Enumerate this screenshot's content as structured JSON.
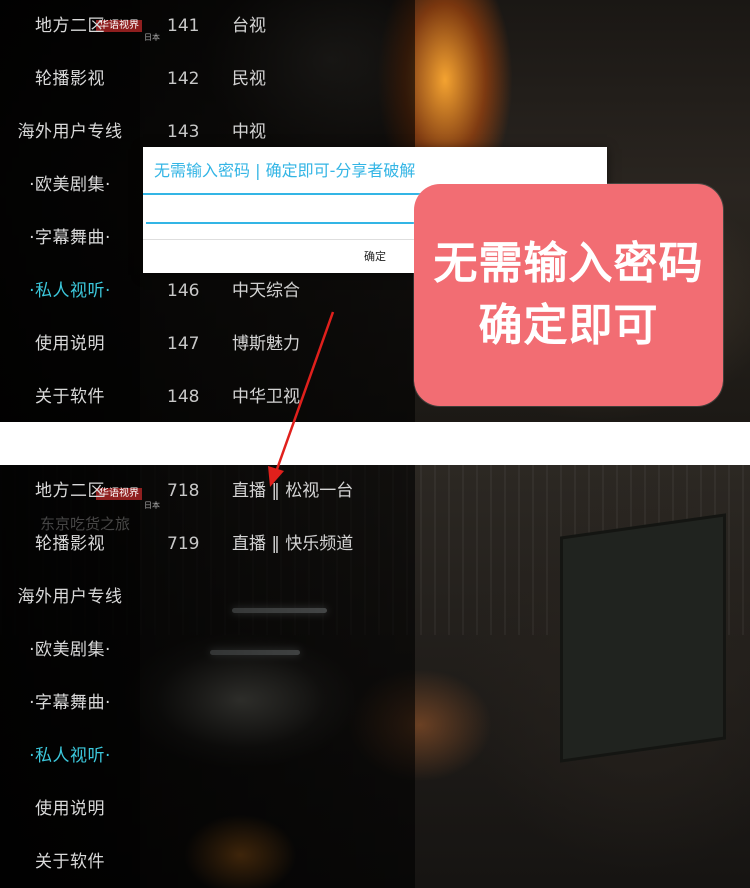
{
  "top_screen": {
    "menu": [
      {
        "label": "地方二区",
        "active": false
      },
      {
        "label": "轮播影视",
        "active": false
      },
      {
        "label": "海外用户专线",
        "active": false
      },
      {
        "label": "·欧美剧集·",
        "active": false
      },
      {
        "label": "·字幕舞曲·",
        "active": false
      },
      {
        "label": "·私人视听·",
        "active": true
      },
      {
        "label": "使用说明",
        "active": false
      },
      {
        "label": "关于软件",
        "active": false
      }
    ],
    "channels": [
      {
        "number": "141",
        "name": "台视"
      },
      {
        "number": "142",
        "name": "民视"
      },
      {
        "number": "143",
        "name": "中视"
      },
      {
        "number": "146",
        "name": "中天综合"
      },
      {
        "number": "147",
        "name": "博斯魅力"
      },
      {
        "number": "148",
        "name": "中华卫视"
      }
    ],
    "logo": {
      "title": "华语视界",
      "sub": "日本"
    }
  },
  "dialog": {
    "title": "无需输入密码 | 确定即可-分享者破解",
    "input_value": "",
    "ok_label": "确定"
  },
  "callout": {
    "line1": "无需输入密码",
    "line2": "确定即可",
    "color": "#f26d73"
  },
  "bottom_screen": {
    "menu": [
      {
        "label": "地方二区",
        "active": false
      },
      {
        "label": "轮播影视",
        "active": false
      },
      {
        "label": "海外用户专线",
        "active": false
      },
      {
        "label": "·欧美剧集·",
        "active": false
      },
      {
        "label": "·字幕舞曲·",
        "active": false
      },
      {
        "label": "·私人视听·",
        "active": true
      },
      {
        "label": "使用说明",
        "active": false
      },
      {
        "label": "关于软件",
        "active": false
      }
    ],
    "channels": [
      {
        "number": "718",
        "name": "直播 ‖ 松视一台"
      },
      {
        "number": "719",
        "name": "直播 ‖ 快乐频道"
      }
    ],
    "logo": {
      "title": "华语视界",
      "sub": "日本"
    },
    "ghost_text": "东京吃货之旅"
  },
  "colors": {
    "accent": "#33b5e5",
    "active_menu": "#3cc8dc",
    "arrow": "#e0201c"
  }
}
